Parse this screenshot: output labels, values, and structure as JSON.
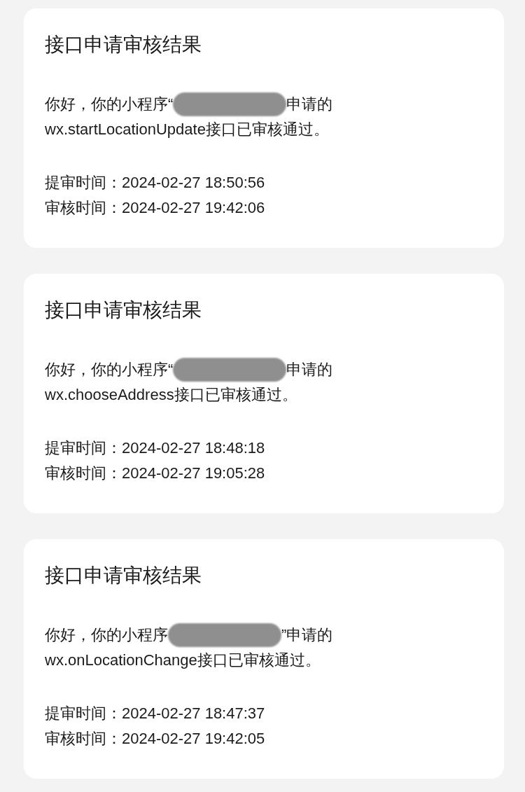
{
  "cards": [
    {
      "title": "接口申请审核结果",
      "greeting_prefix": "你好，你的小程序“",
      "greeting_suffix": "申请的",
      "result": "wx.startLocationUpdate接口已审核通过。",
      "submitted": "提审时间：2024-02-27 18:50:56",
      "reviewed": "审核时间：2024-02-27 19:42:06"
    },
    {
      "title": "接口申请审核结果",
      "greeting_prefix": "你好，你的小程序“",
      "greeting_suffix": "申请的",
      "result": "wx.chooseAddress接口已审核通过。",
      "submitted": "提审时间：2024-02-27 18:48:18",
      "reviewed": "审核时间：2024-02-27 19:05:28"
    },
    {
      "title": "接口申请审核结果",
      "greeting_prefix": "你好，你的小程序",
      "greeting_suffix": "”申请的",
      "result": "wx.onLocationChange接口已审核通过。",
      "submitted": "提审时间：2024-02-27 18:47:37",
      "reviewed": "审核时间：2024-02-27 19:42:05"
    }
  ]
}
